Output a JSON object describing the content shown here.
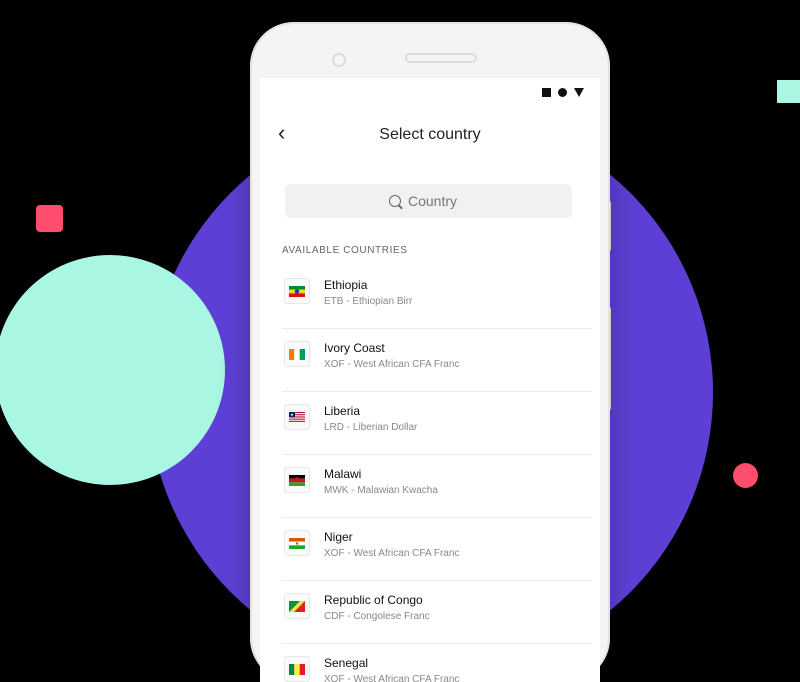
{
  "header": {
    "title": "Select country",
    "back_icon": "chevron-left-icon"
  },
  "search": {
    "placeholder": "Country",
    "icon": "search-icon"
  },
  "status_bar": {
    "icons": [
      "square-icon",
      "circle-icon",
      "triangle-icon"
    ]
  },
  "section_label": "AVAILABLE COUNTRIES",
  "countries": [
    {
      "name": "Ethiopia",
      "currency": "ETB - Ethiopian Birr",
      "flag": "ethiopia-flag-icon"
    },
    {
      "name": "Ivory Coast",
      "currency": "XOF - West African CFA Franc",
      "flag": "ivory-coast-flag-icon"
    },
    {
      "name": "Liberia",
      "currency": "LRD - Liberian Dollar",
      "flag": "liberia-flag-icon"
    },
    {
      "name": "Malawi",
      "currency": "MWK - Malawian Kwacha",
      "flag": "malawi-flag-icon"
    },
    {
      "name": "Niger",
      "currency": "XOF - West African CFA Franc",
      "flag": "niger-flag-icon"
    },
    {
      "name": "Republic of Congo",
      "currency": "CDF - Congolese Franc",
      "flag": "congo-flag-icon"
    },
    {
      "name": "Senegal",
      "currency": "XOF - West African CFA Franc",
      "flag": "senegal-flag-icon"
    }
  ],
  "colors": {
    "purple": "#5e3fd6",
    "mint": "#a9f6e2",
    "pink": "#ff4d6d",
    "background": "#000000"
  }
}
